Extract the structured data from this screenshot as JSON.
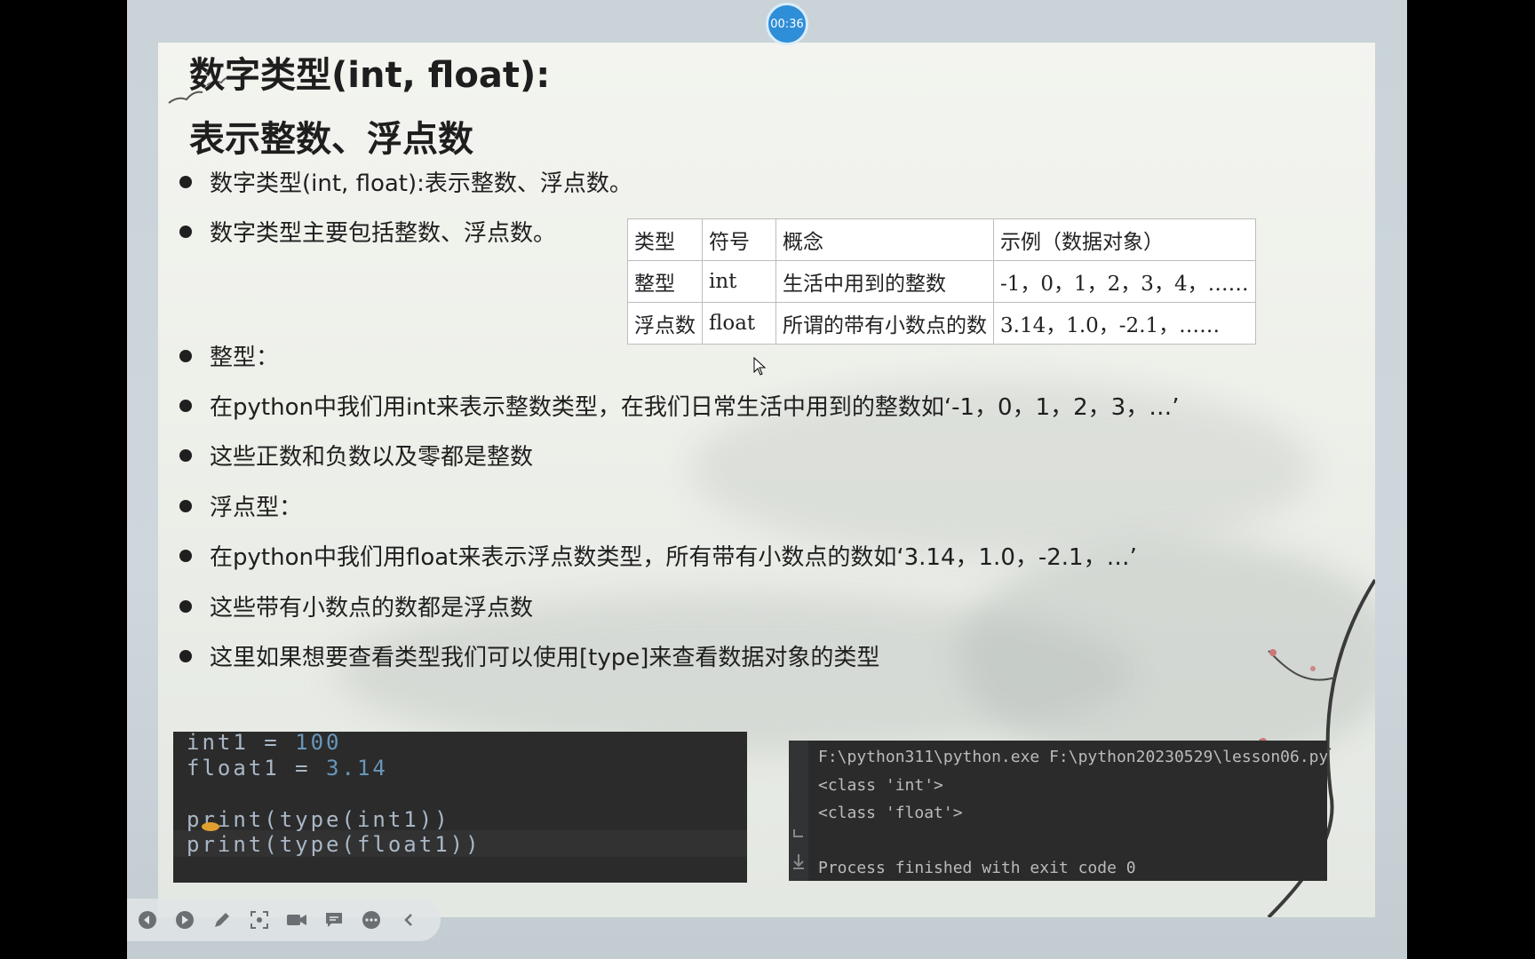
{
  "timer": "00:36",
  "slide": {
    "title_line1": "数字类型(int, float):",
    "title_line2": "表示整数、浮点数",
    "bullets": [
      "数字类型(int, float):表示整数、浮点数。",
      "数字类型主要包括整数、浮点数。",
      "整型：",
      "在python中我们用int来表示整数类型，在我们日常生活中用到的整数如‘-1，0，1，2，3，…’",
      "这些正数和负数以及零都是整数",
      "浮点型：",
      "在python中我们用float来表示浮点数类型，所有带有小数点的数如‘3.14，1.0，-2.1，…’",
      "这些带有小数点的数都是浮点数",
      "这里如果想要查看类型我们可以使用[type]来查看数据对象的类型"
    ],
    "table": {
      "header": [
        "类型",
        "符号",
        "概念",
        "示例（数据对象）"
      ],
      "rows": [
        [
          "整型",
          "int",
          "生活中用到的整数",
          "-1，0，1，2，3，4，……"
        ],
        [
          "浮点数",
          "float",
          "所谓的带有小数点的数",
          "3.14，1.0，-2.1，……"
        ]
      ]
    }
  },
  "code": {
    "line1_var": "int1 = ",
    "line1_num": "100",
    "line2_var": "float1 = ",
    "line2_num": "3.14",
    "line3": "print(type(int1))",
    "line4": "print(type(float1))"
  },
  "terminal": {
    "lines": [
      "F:\\python311\\python.exe F:\\python20230529\\lesson06.py",
      "<class 'int'>",
      "<class 'float'>",
      "",
      "Process finished with exit code 0"
    ]
  },
  "toolbar": {
    "icons": [
      "prev-icon",
      "play-icon",
      "pen-icon",
      "screenshot-icon",
      "camera-icon",
      "comment-icon",
      "more-icon",
      "collapse-icon"
    ]
  }
}
